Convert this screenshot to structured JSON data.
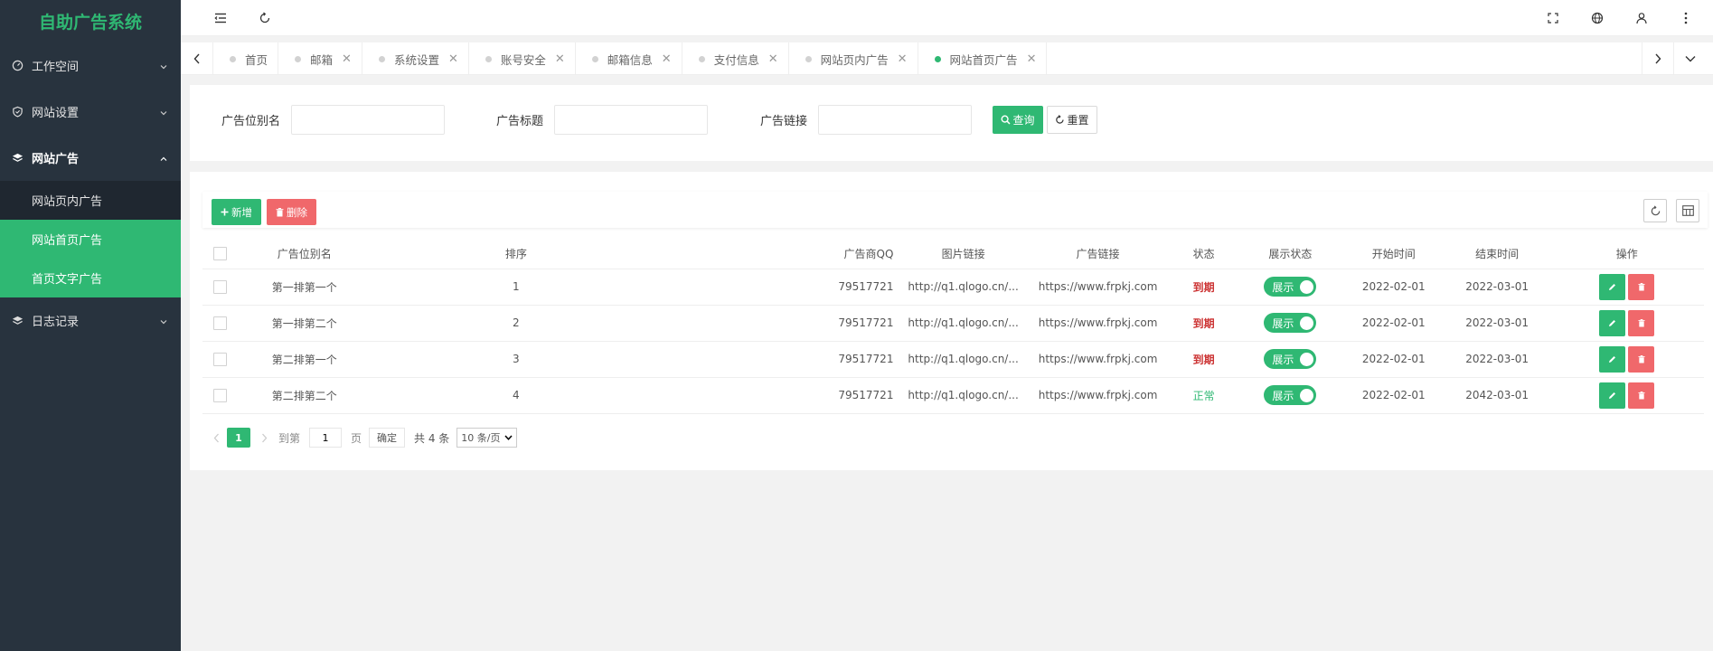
{
  "app": {
    "title": "自助广告系统"
  },
  "sidebar": {
    "menus": [
      {
        "label": "工作空间",
        "icon": "dashboard-icon"
      },
      {
        "label": "网站设置",
        "icon": "shield-icon"
      },
      {
        "label": "网站广告",
        "icon": "layers-icon"
      },
      {
        "label": "日志记录",
        "icon": "layers-icon"
      }
    ],
    "submenu": [
      "网站页内广告",
      "网站首页广告",
      "首页文字广告"
    ]
  },
  "tabs": [
    {
      "label": "首页"
    },
    {
      "label": "邮箱"
    },
    {
      "label": "系统设置"
    },
    {
      "label": "账号安全"
    },
    {
      "label": "邮箱信息"
    },
    {
      "label": "支付信息"
    },
    {
      "label": "网站页内广告"
    },
    {
      "label": "网站首页广告"
    }
  ],
  "search": {
    "field1_label": "广告位别名",
    "field2_label": "广告标题",
    "field3_label": "广告链接",
    "query_label": "查询",
    "reset_label": "重置"
  },
  "toolbar": {
    "add_label": "新增",
    "delete_label": "删除"
  },
  "table": {
    "headers": [
      "广告位别名",
      "排序",
      "广告商QQ",
      "图片链接",
      "广告链接",
      "状态",
      "展示状态",
      "开始时间",
      "结束时间",
      "操作"
    ],
    "rows": [
      {
        "alias": "第一排第一个",
        "sort": "1",
        "qq": "79517721",
        "img": "http://q1.qlogo.cn/...",
        "link": "https://www.frpkj.com",
        "status": "到期",
        "show": "展示",
        "start": "2022-02-01",
        "end": "2022-03-01"
      },
      {
        "alias": "第一排第二个",
        "sort": "2",
        "qq": "79517721",
        "img": "http://q1.qlogo.cn/...",
        "link": "https://www.frpkj.com",
        "status": "到期",
        "show": "展示",
        "start": "2022-02-01",
        "end": "2022-03-01"
      },
      {
        "alias": "第二排第一个",
        "sort": "3",
        "qq": "79517721",
        "img": "http://q1.qlogo.cn/...",
        "link": "https://www.frpkj.com",
        "status": "到期",
        "show": "展示",
        "start": "2022-02-01",
        "end": "2022-03-01"
      },
      {
        "alias": "第二排第二个",
        "sort": "4",
        "qq": "79517721",
        "img": "http://q1.qlogo.cn/...",
        "link": "https://www.frpkj.com",
        "status": "正常",
        "show": "展示",
        "start": "2022-02-01",
        "end": "2042-03-01"
      }
    ]
  },
  "pager": {
    "current": "1",
    "goto_label": "到第",
    "goto_value": "1",
    "page_label": "页",
    "confirm_label": "确定",
    "total_label": "共 4 条",
    "page_size": "10 条/页"
  },
  "colors": {
    "accent": "#2fb873",
    "danger": "#f0686b",
    "expired": "#cc3333",
    "sidebar": "#28333e"
  }
}
